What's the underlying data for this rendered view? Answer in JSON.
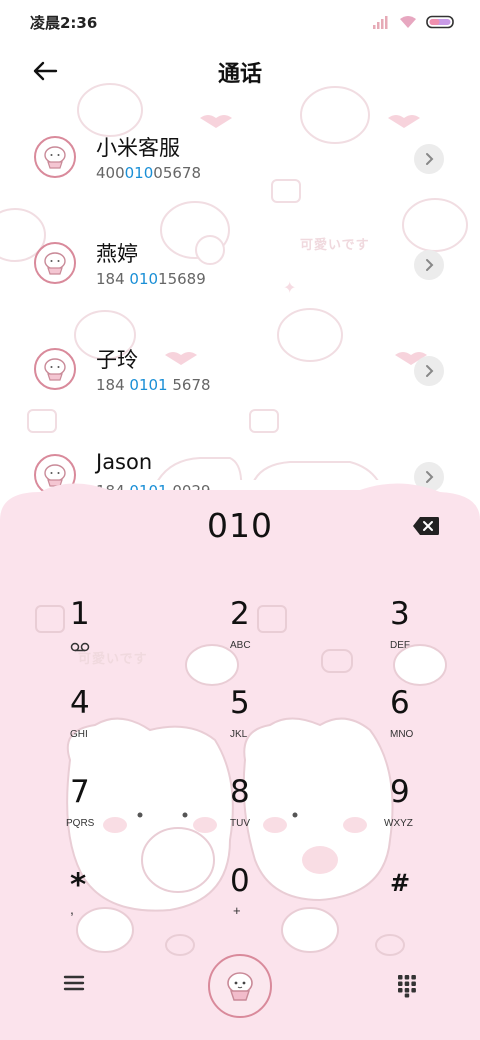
{
  "status_bar": {
    "time": "凌晨2:36"
  },
  "header": {
    "title": "通话"
  },
  "contacts": [
    {
      "name": "小米客服",
      "number_pre": "400",
      "number_hl": "010",
      "number_post": "05678"
    },
    {
      "name": "燕婷",
      "number_pre": "184 ",
      "number_hl": "010",
      "number_post": "15689"
    },
    {
      "name": "子玲",
      "number_pre": "184 ",
      "number_hl": "0101",
      "number_post": " 5678"
    },
    {
      "name": "Jason",
      "number_pre": "184 ",
      "number_hl": "0101",
      "number_post": " 0029"
    }
  ],
  "dialer": {
    "display": "010",
    "keys": [
      {
        "digit": "1",
        "sub": "voicemail"
      },
      {
        "digit": "2",
        "sub": "ABC"
      },
      {
        "digit": "3",
        "sub": "DEF"
      },
      {
        "digit": "4",
        "sub": "GHI"
      },
      {
        "digit": "5",
        "sub": "JKL"
      },
      {
        "digit": "6",
        "sub": "MNO"
      },
      {
        "digit": "7",
        "sub": "PQRS"
      },
      {
        "digit": "8",
        "sub": "TUV"
      },
      {
        "digit": "9",
        "sub": "WXYZ"
      },
      {
        "digit": "*",
        "sub": ","
      },
      {
        "digit": "0",
        "sub": "+"
      },
      {
        "digit": "#",
        "sub": ""
      }
    ]
  },
  "wallpaper": {
    "stamp_text": "可愛いです"
  },
  "colors": {
    "accent_pink": "#d98a9b",
    "panel_pink": "#fbe3ec",
    "highlight_blue": "#1a8fd6"
  },
  "icons": {
    "back": "arrow-left-icon",
    "chevron": "chevron-right-icon",
    "backspace": "backspace-icon",
    "menu": "menu-icon",
    "call": "call-icon",
    "keypad": "dialpad-icon"
  }
}
